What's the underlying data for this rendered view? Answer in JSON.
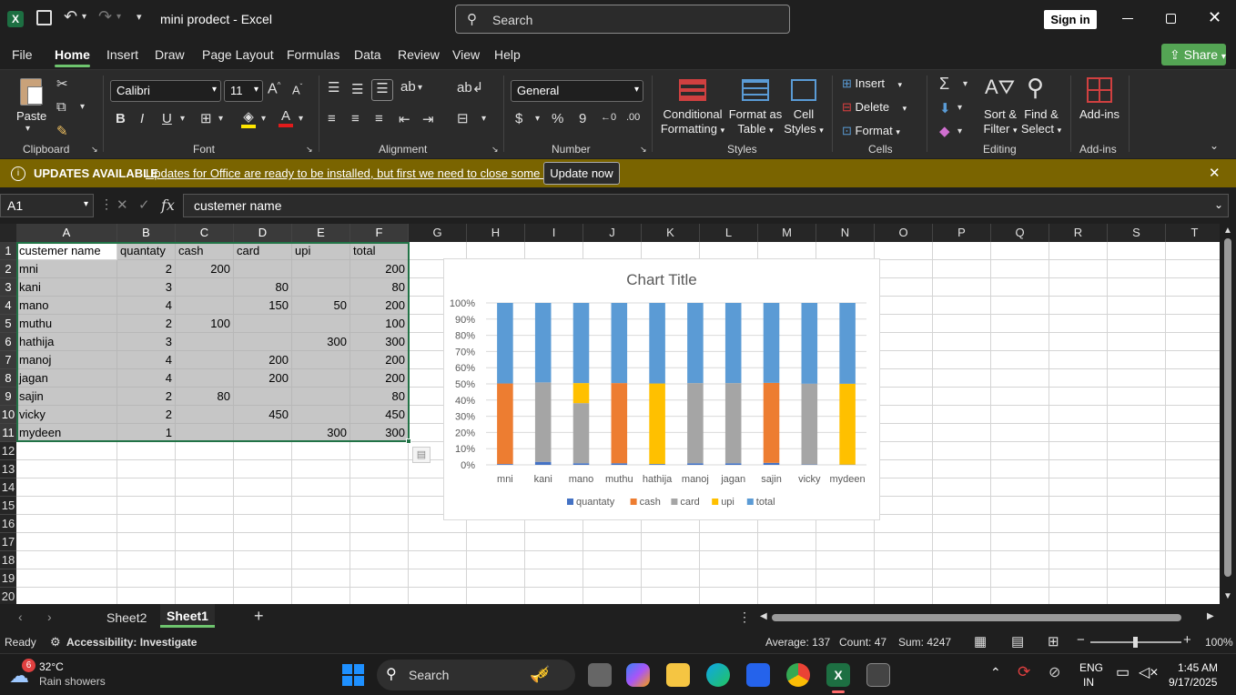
{
  "titlebar": {
    "app_title": "mini prodect  -  Excel",
    "search_placeholder": "Search",
    "signin": "Sign in"
  },
  "menu": {
    "tabs": [
      "File",
      "Home",
      "Insert",
      "Draw",
      "Page Layout",
      "Formulas",
      "Data",
      "Review",
      "View",
      "Help"
    ],
    "share": "Share"
  },
  "ribbon": {
    "clipboard": {
      "paste": "Paste",
      "label": "Clipboard"
    },
    "font": {
      "name": "Calibri",
      "size": "11",
      "label": "Font"
    },
    "alignment": {
      "label": "Alignment"
    },
    "number": {
      "format": "General",
      "label": "Number"
    },
    "styles": {
      "conditional": "Conditional",
      "formatting": "Formatting",
      "format_as": "Format as",
      "table": "Table",
      "cell": "Cell",
      "styles": "Styles",
      "label": "Styles"
    },
    "cells": {
      "insert": "Insert",
      "delete": "Delete",
      "format": "Format",
      "label": "Cells"
    },
    "editing": {
      "sort": "Sort &",
      "filter": "Filter",
      "find": "Find &",
      "select": "Select",
      "label": "Editing"
    },
    "addins": {
      "addins": "Add-ins",
      "label": "Add-ins"
    }
  },
  "update": {
    "title": "UPDATES AVAILABLE",
    "message": "Updates for Office are ready to be installed, but first we need to close some apps.",
    "button": "Update now"
  },
  "formula": {
    "namebox": "A1",
    "fx": "fx",
    "content": "custemer name"
  },
  "columns": [
    "A",
    "B",
    "C",
    "D",
    "E",
    "F",
    "G",
    "H",
    "I",
    "J",
    "K",
    "L",
    "M",
    "N",
    "O",
    "P",
    "Q",
    "R",
    "S",
    "T"
  ],
  "rows": [
    "1",
    "2",
    "3",
    "4",
    "5",
    "6",
    "7",
    "8",
    "9",
    "10",
    "11",
    "12",
    "13",
    "14",
    "15",
    "16",
    "17",
    "18",
    "19",
    "20"
  ],
  "table": {
    "headers": [
      "custemer name",
      "quantaty",
      "cash",
      "card",
      "upi",
      "total"
    ],
    "data": [
      [
        "mni",
        "2",
        "200",
        "",
        "",
        "200"
      ],
      [
        "kani",
        "3",
        "",
        "80",
        "",
        "80"
      ],
      [
        "mano",
        "4",
        "",
        "150",
        "50",
        "200"
      ],
      [
        "muthu",
        "2",
        "100",
        "",
        "",
        "100"
      ],
      [
        "hathija",
        "3",
        "",
        "",
        "300",
        "300"
      ],
      [
        "manoj",
        "4",
        "",
        "200",
        "",
        "200"
      ],
      [
        "jagan",
        "4",
        "",
        "200",
        "",
        "200"
      ],
      [
        "sajin",
        "2",
        "80",
        "",
        "",
        "80"
      ],
      [
        "vicky",
        "2",
        "",
        "450",
        "",
        "450"
      ],
      [
        "mydeen",
        "1",
        "",
        "",
        "300",
        "300"
      ]
    ]
  },
  "chart_data": {
    "type": "bar",
    "stacked": "100%",
    "title": "Chart Title",
    "categories": [
      "mni",
      "kani",
      "mano",
      "muthu",
      "hathija",
      "manoj",
      "jagan",
      "sajin",
      "vicky",
      "mydeen"
    ],
    "series": [
      {
        "name": "quantaty",
        "color": "#4472c4",
        "values": [
          2,
          3,
          4,
          2,
          3,
          4,
          4,
          2,
          2,
          1
        ]
      },
      {
        "name": "cash",
        "color": "#ed7d31",
        "values": [
          200,
          0,
          0,
          100,
          0,
          0,
          0,
          80,
          0,
          0
        ]
      },
      {
        "name": "card",
        "color": "#a5a5a5",
        "values": [
          0,
          80,
          150,
          0,
          0,
          200,
          200,
          0,
          450,
          0
        ]
      },
      {
        "name": "upi",
        "color": "#ffc000",
        "values": [
          0,
          0,
          50,
          0,
          300,
          0,
          0,
          0,
          0,
          300
        ]
      },
      {
        "name": "total",
        "color": "#5b9bd5",
        "values": [
          200,
          80,
          200,
          100,
          300,
          200,
          200,
          80,
          450,
          300
        ]
      }
    ],
    "yticks": [
      "0%",
      "10%",
      "20%",
      "30%",
      "40%",
      "50%",
      "60%",
      "70%",
      "80%",
      "90%",
      "100%"
    ],
    "legend": "bottom"
  },
  "sheets": {
    "tabs": [
      "Sheet2",
      "Sheet1"
    ],
    "active": "Sheet1"
  },
  "status": {
    "ready": "Ready",
    "accessibility": "Accessibility: Investigate",
    "average": "Average: 137",
    "count": "Count: 47",
    "sum": "Sum: 4247",
    "zoom": "100%"
  },
  "taskbar": {
    "weather_temp": "32°C",
    "weather_desc": "Rain showers",
    "weather_badge": "6",
    "search": "Search",
    "lang1": "ENG",
    "lang2": "IN",
    "time": "1:45 AM",
    "date": "9/17/2025"
  }
}
